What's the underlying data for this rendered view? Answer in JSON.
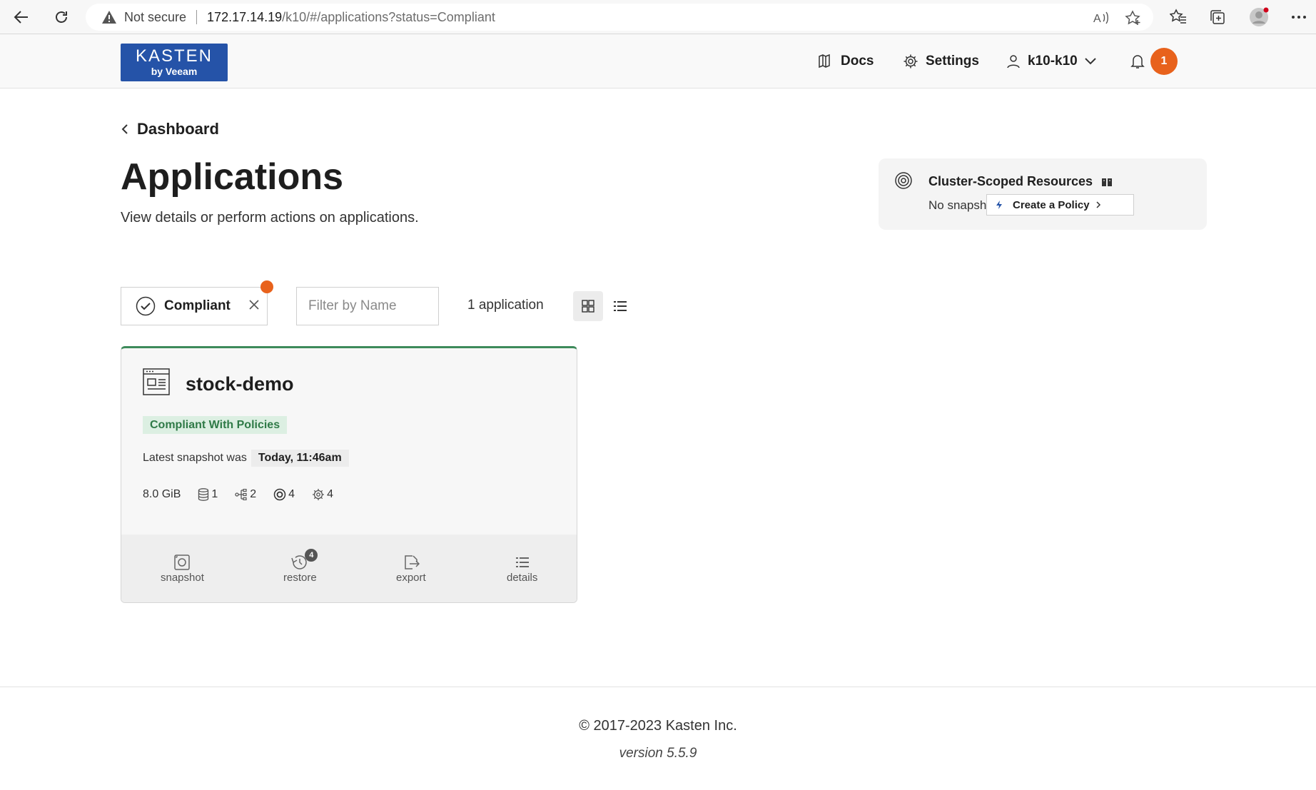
{
  "browser": {
    "not_secure": "Not secure",
    "url_host": "172.17.14.19",
    "url_path": "/k10/#/applications?status=Compliant"
  },
  "header": {
    "logo_line1": "KASTEN",
    "logo_line2": "by Veeam",
    "docs": "Docs",
    "settings": "Settings",
    "user": "k10-k10",
    "notification_count": "1"
  },
  "breadcrumb": {
    "label": "Dashboard"
  },
  "page": {
    "title": "Applications",
    "subtitle": "View details or perform actions on applications."
  },
  "cluster": {
    "title": "Cluster-Scoped Resources",
    "status": "No snapshots",
    "create_policy": "Create a Policy"
  },
  "filters": {
    "chip_label": "Compliant",
    "search_placeholder": "Filter by Name",
    "count": "1 application"
  },
  "app": {
    "name": "stock-demo",
    "badge": "Compliant With Policies",
    "snapshot_label": "Latest snapshot was",
    "snapshot_time": "Today, 11:46am",
    "size": "8.0 GiB",
    "volumes": "1",
    "workloads": "2",
    "policies": "4",
    "configs": "4",
    "actions": {
      "snapshot": "snapshot",
      "restore": "restore",
      "restore_count": "4",
      "export": "export",
      "details": "details"
    }
  },
  "footer": {
    "copyright": "© 2017-2023 Kasten Inc.",
    "version": "version 5.5.9"
  },
  "colors": {
    "brand": "#2553a8",
    "accent": "#e8621c",
    "compliant_green": "#2f7a47",
    "compliant_bg": "#dcefe2"
  }
}
